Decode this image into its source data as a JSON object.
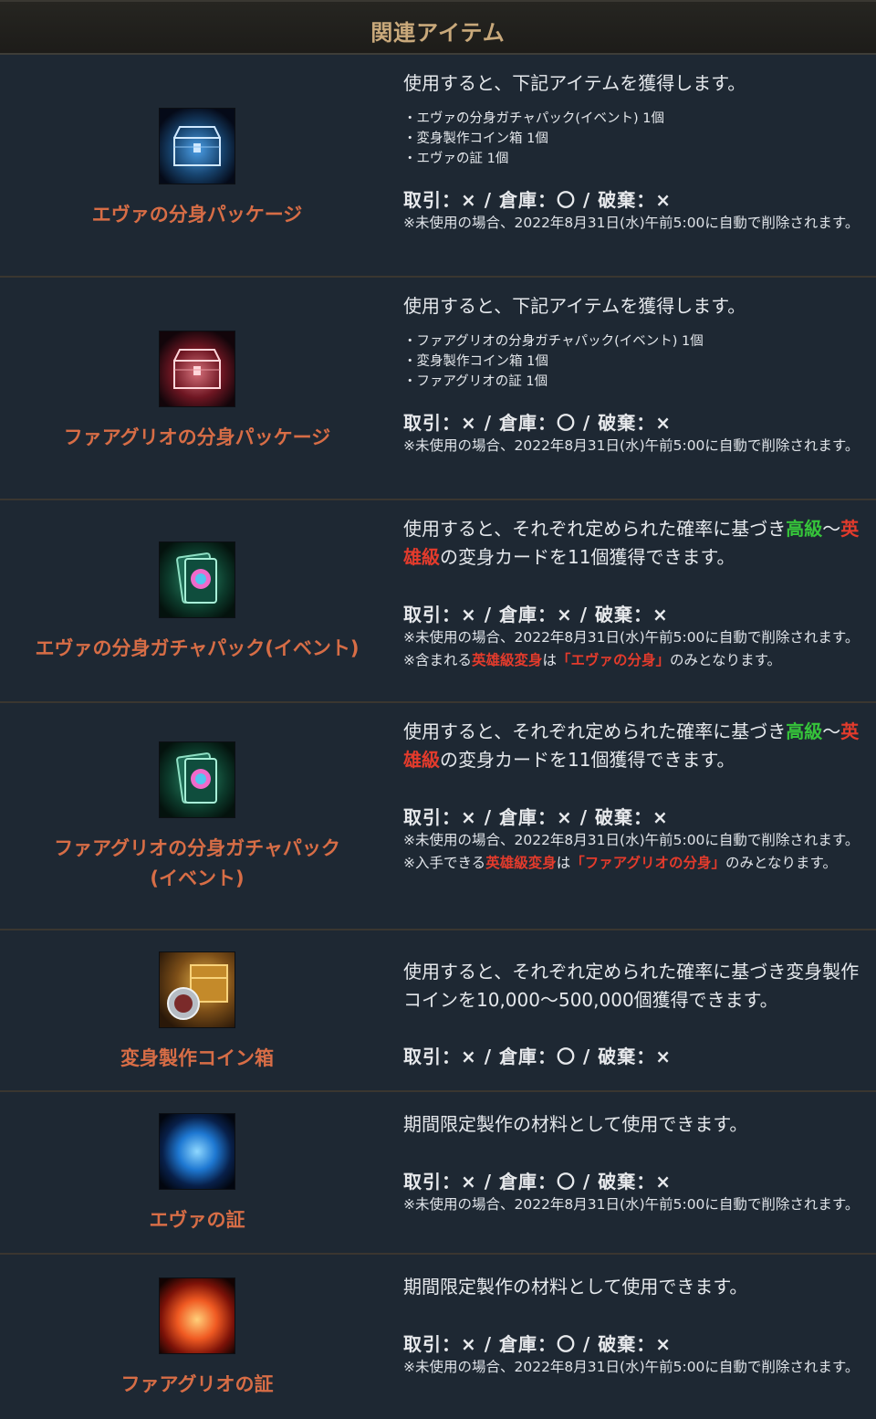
{
  "header": {
    "title": "関連アイテム"
  },
  "items": [
    {
      "name": "エヴァの分身パッケージ",
      "icon": "blue-chest-icon",
      "desc": "使用すると、下記アイテムを獲得します。",
      "bullets": [
        "・エヴァの分身ガチャパック(イベント) 1個",
        "・変身製作コイン箱 1個",
        "・エヴァの証 1個"
      ],
      "status": "取引：× / 倉庫：〇 / 破棄：×",
      "note": "※未使用の場合、2022年8月31日(水)午前5:00に自動で削除されます。"
    },
    {
      "name": "ファアグリオの分身パッケージ",
      "icon": "red-chest-icon",
      "desc": "使用すると、下記アイテムを獲得します。",
      "bullets": [
        "・ファアグリオの分身ガチャパック(イベント) 1個",
        "・変身製作コイン箱 1個",
        "・ファアグリオの証 1個"
      ],
      "status": "取引：× / 倉庫：〇 / 破棄：×",
      "note": "※未使用の場合、2022年8月31日(水)午前5:00に自動で削除されます。"
    },
    {
      "name": "エヴァの分身ガチャパック(イベント)",
      "icon": "transform-card-icon",
      "desc_a": "使用すると、それぞれ定められた確率に基づき",
      "desc_green": "高級",
      "desc_b": "～",
      "desc_red": "英雄級",
      "desc_c": "の変身カードを11個獲得できます。",
      "status": "取引：× / 倉庫：× / 破棄：×",
      "note": "※未使用の場合、2022年8月31日(水)午前5:00に自動で削除されます。",
      "note2_a": "※含まれる",
      "note2_red": "英雄級変身",
      "note2_b": "は",
      "note2_red2": "「エヴァの分身」",
      "note2_c": "のみとなります。"
    },
    {
      "name": "ファアグリオの分身ガチャパック(イベント)",
      "icon": "transform-card-icon",
      "desc_a": "使用すると、それぞれ定められた確率に基づき",
      "desc_green": "高級",
      "desc_b": "～",
      "desc_red": "英雄級",
      "desc_c": "の変身カードを11個獲得できます。",
      "status": "取引：× / 倉庫：× / 破棄：×",
      "note": "※未使用の場合、2022年8月31日(水)午前5:00に自動で削除されます。",
      "note2_a": "※入手できる",
      "note2_red": "英雄級変身",
      "note2_b": "は",
      "note2_red2": "「ファアグリオの分身」",
      "note2_c": "のみとなります。"
    },
    {
      "name": "変身製作コイン箱",
      "icon": "coin-chest-icon",
      "desc": "使用すると、それぞれ定められた確率に基づき変身製作コインを10,000～500,000個獲得できます。",
      "status": "取引：× / 倉庫：〇 / 破棄：×"
    },
    {
      "name": "エヴァの証",
      "icon": "blue-orb-icon",
      "desc": "期間限定製作の材料として使用できます。",
      "status": "取引：× / 倉庫：〇 / 破棄：×",
      "note": "※未使用の場合、2022年8月31日(水)午前5:00に自動で削除されます。"
    },
    {
      "name": "ファアグリオの証",
      "icon": "red-orb-icon",
      "desc": "期間限定製作の材料として使用できます。",
      "status": "取引：× / 倉庫：〇 / 破棄：×",
      "note": "※未使用の場合、2022年8月31日(水)午前5:00に自動で削除されます。"
    }
  ],
  "colors": {
    "item_name": "#d76d46",
    "green_highlight": "#36c43a",
    "red_highlight": "#e43b2c",
    "header_text": "#c9a97b",
    "background": "#1e2833"
  }
}
